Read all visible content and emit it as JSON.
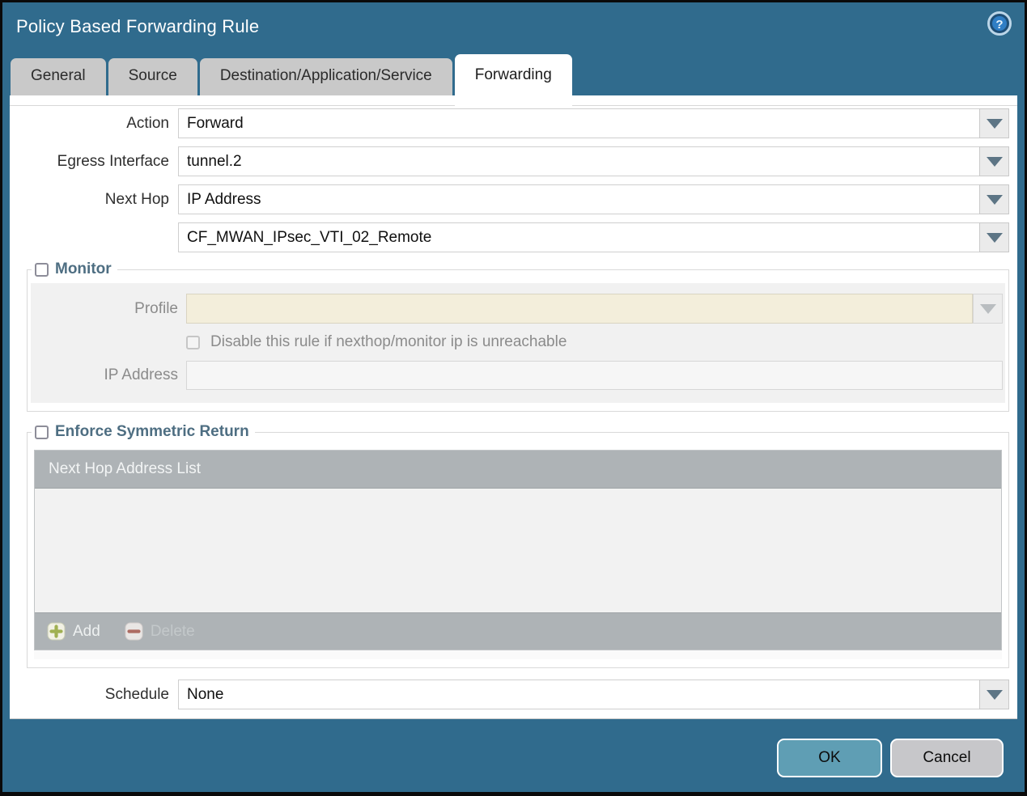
{
  "window": {
    "title": "Policy Based Forwarding Rule"
  },
  "tabs": [
    {
      "label": "General",
      "active": false
    },
    {
      "label": "Source",
      "active": false
    },
    {
      "label": "Destination/Application/Service",
      "active": false
    },
    {
      "label": "Forwarding",
      "active": true
    }
  ],
  "form": {
    "action": {
      "label": "Action",
      "value": "Forward"
    },
    "egress_interface": {
      "label": "Egress Interface",
      "value": "tunnel.2"
    },
    "next_hop": {
      "label": "Next Hop",
      "value": "IP Address"
    },
    "next_hop_address": {
      "value": "CF_MWAN_IPsec_VTI_02_Remote"
    },
    "schedule": {
      "label": "Schedule",
      "value": "None"
    }
  },
  "monitor": {
    "legend": "Monitor",
    "checked": false,
    "profile_label": "Profile",
    "profile_value": "",
    "disable_rule_label": "Disable this rule if nexthop/monitor ip is unreachable",
    "disable_rule_checked": false,
    "ip_address_label": "IP Address",
    "ip_address_value": ""
  },
  "symmetric_return": {
    "legend": "Enforce Symmetric Return",
    "checked": false,
    "table_header": "Next Hop Address List",
    "rows": [],
    "add_label": "Add",
    "delete_label": "Delete"
  },
  "footer": {
    "ok_label": "OK",
    "cancel_label": "Cancel"
  },
  "colors": {
    "background_teal": "#306b8d",
    "inactive_tab": "#c9c9c9",
    "legend_slate": "#4e6e82",
    "grid_bar_gray": "#aeb3b6",
    "disabled_field_cream": "#f3eedb",
    "ok_button": "#5f9eb4",
    "cancel_button": "#c7c7ca"
  }
}
